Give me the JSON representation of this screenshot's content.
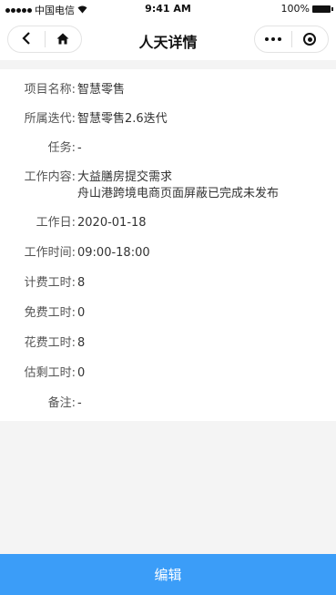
{
  "status_bar": {
    "carrier": "中国电信",
    "time": "9:41 AM",
    "battery": "100%"
  },
  "nav": {
    "title": "人天详情"
  },
  "details": [
    {
      "label": "项目名称:",
      "value": "智慧零售"
    },
    {
      "label": "所属迭代:",
      "value": "智慧零售2.6迭代"
    },
    {
      "label": "任务:",
      "value": "-"
    },
    {
      "label": "工作内容:",
      "value": "大益膳房提交需求",
      "value2": "舟山港跨境电商页面屏蔽已完成未发布"
    },
    {
      "label": "工作日:",
      "value": "2020-01-18"
    },
    {
      "label": "工作时间:",
      "value": "09:00-18:00"
    },
    {
      "label": "计费工时:",
      "value": "8"
    },
    {
      "label": "免费工时:",
      "value": "0"
    },
    {
      "label": "花费工时:",
      "value": "8"
    },
    {
      "label": "估剩工时:",
      "value": "0"
    },
    {
      "label": "备注:",
      "value": "-"
    }
  ],
  "footer": {
    "edit_label": "编辑"
  }
}
